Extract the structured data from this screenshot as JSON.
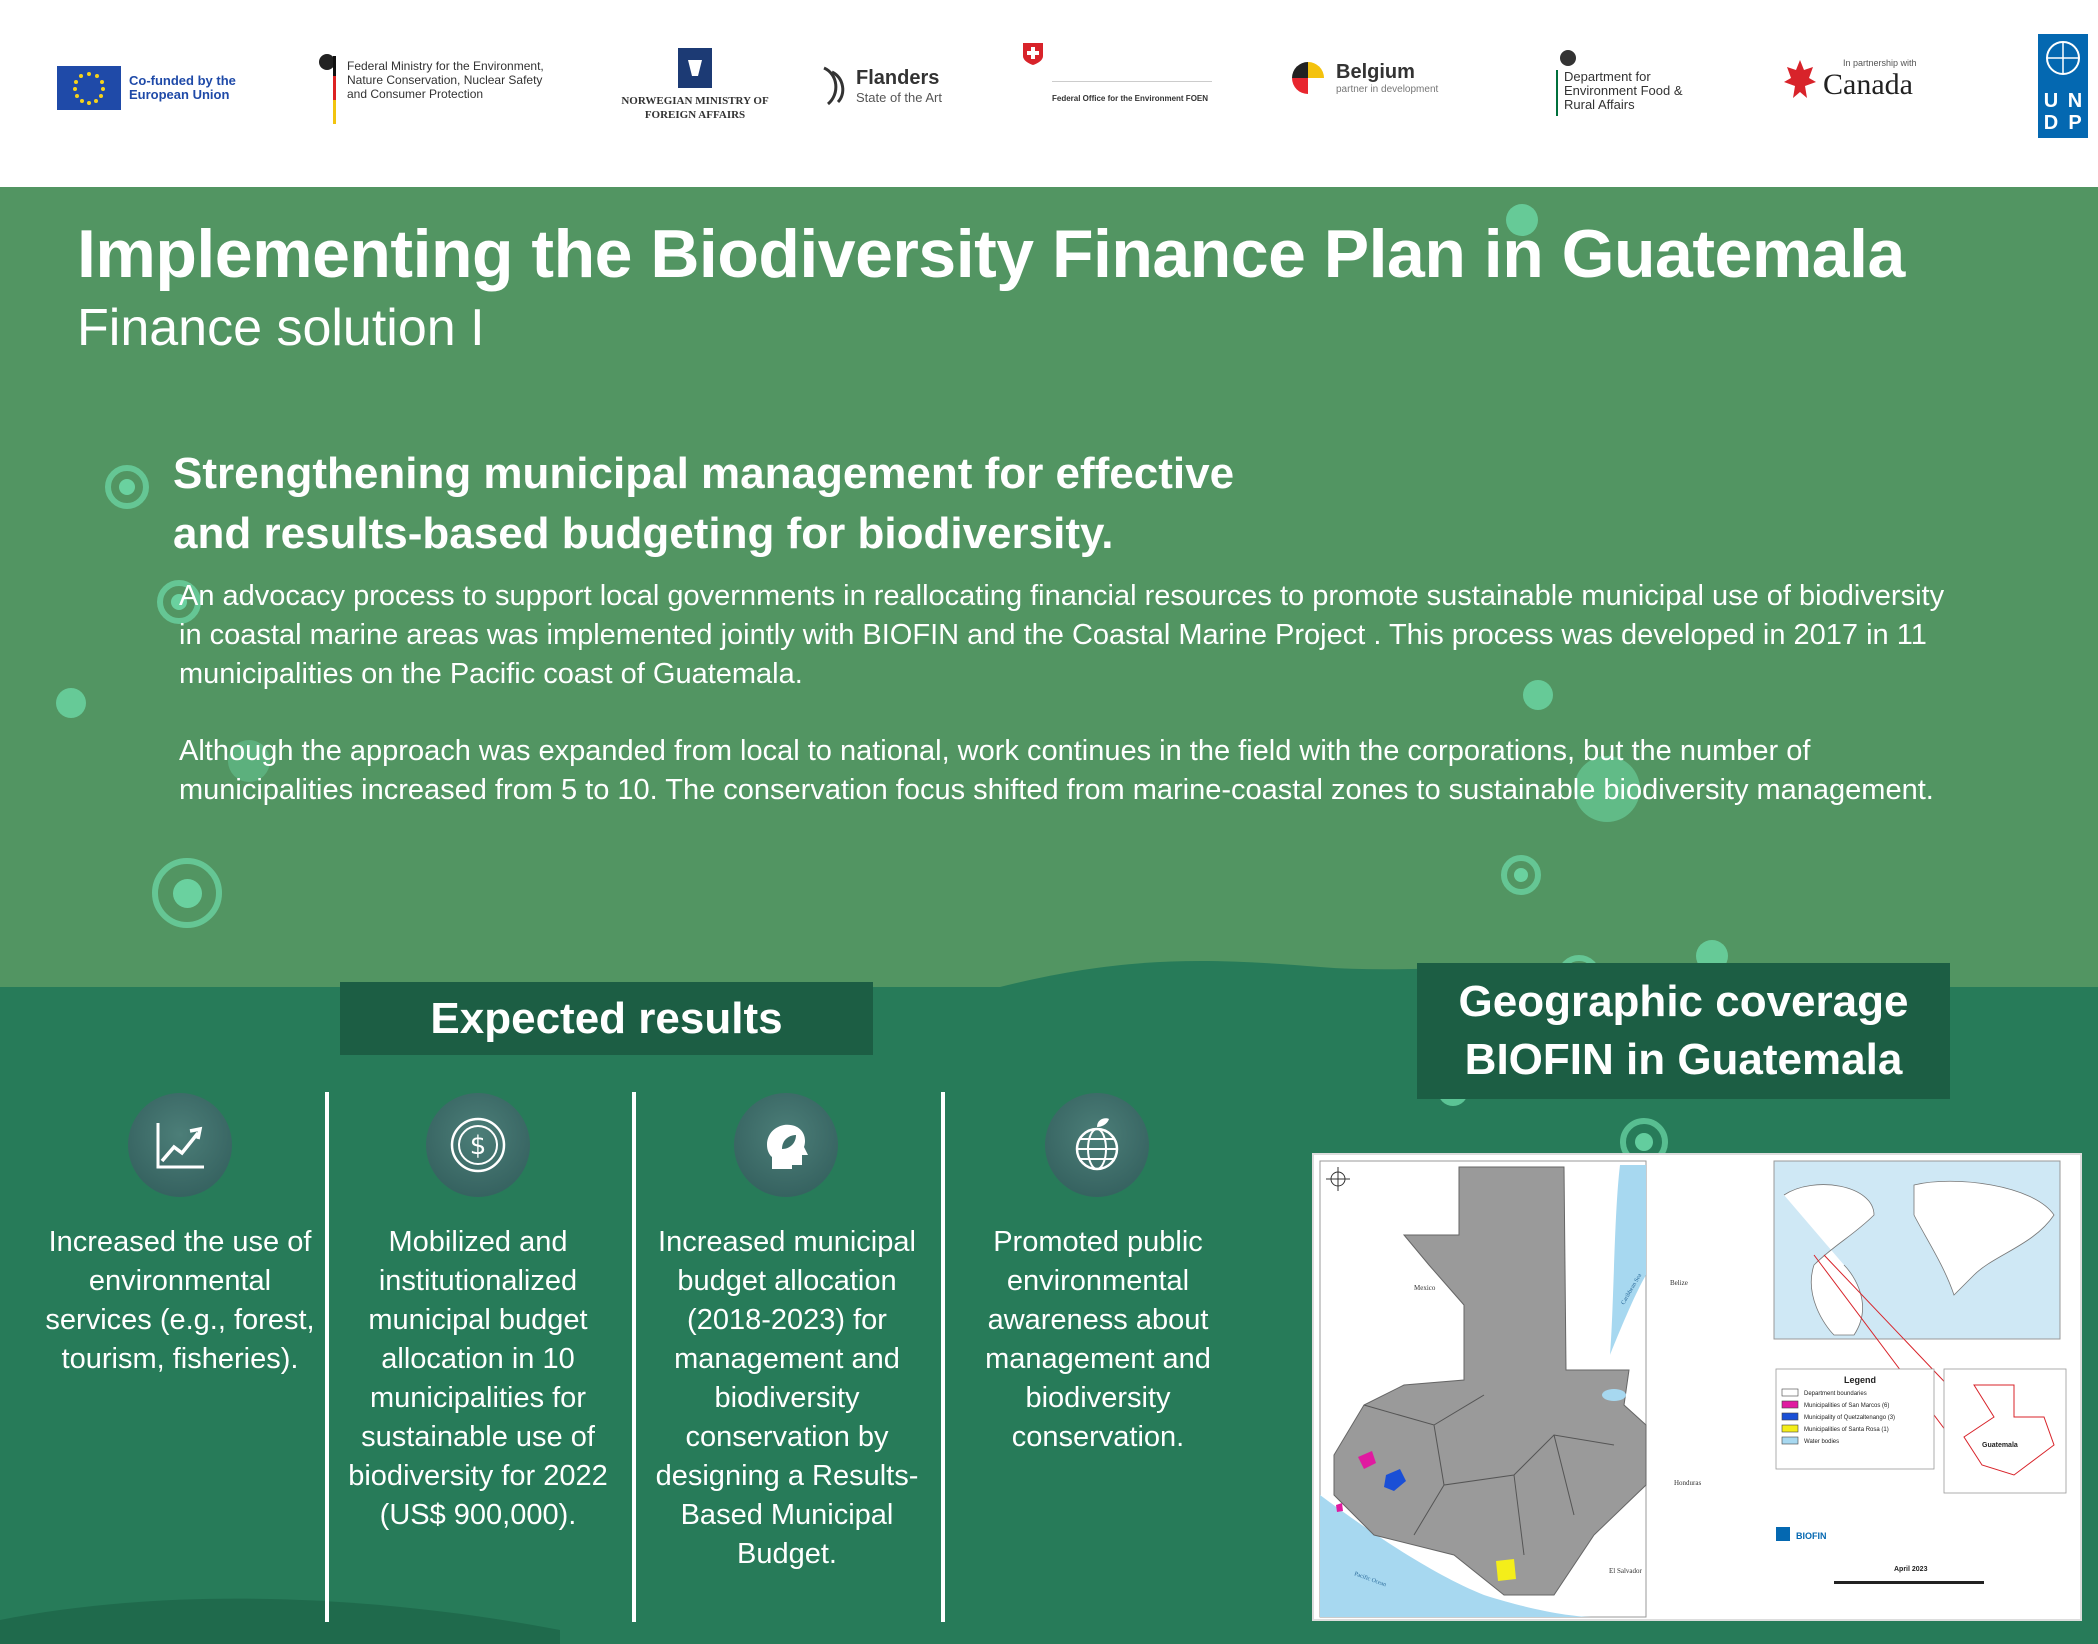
{
  "logos": {
    "eu": "Co-funded by the European Union",
    "germany": "Federal Ministry for the Environment, Nature Conservation, Nuclear Safety and Consumer Protection",
    "norway": "NORWEGIAN MINISTRY OF FOREIGN AFFAIRS",
    "flanders_name": "Flanders",
    "flanders_tag": "State of the Art",
    "swiss": "Federal Office for the Environment FOEN",
    "belgium_name": "Belgium",
    "belgium_tag": "partner in development",
    "uk": "Department for Environment Food & Rural Affairs",
    "canada_tag": "In partnership with",
    "canada_name": "Canada",
    "undp": [
      "U",
      "N",
      "D",
      "P"
    ]
  },
  "header": {
    "title": "Implementing the Biodiversity Finance Plan in Guatemala",
    "subtitle": "Finance solution I"
  },
  "section": {
    "heading_line1": "Strengthening municipal management for effective",
    "heading_line2": "and results-based budgeting for biodiversity.",
    "para1": "An advocacy process to support local governments in reallocating financial resources to promote sustainable municipal use of biodiversity in coastal marine areas was implemented jointly with BIOFIN and the Coastal Marine Project . This process was developed in 2017 in 11 municipalities on the Pacific coast of Guatemala.",
    "para2": "Although the approach was expanded from local to national, work continues in the field with the corporations, but the number of municipalities increased from 5 to 10. The conservation focus shifted from marine-coastal zones to sustainable biodiversity management."
  },
  "results": {
    "title": "Expected results",
    "items": [
      {
        "icon": "trend-up-icon",
        "text": "Increased the use of environmental services (e.g., forest, tourism, fisheries)."
      },
      {
        "icon": "dollar-coin-icon",
        "text": "Mobilized and institutionalized municipal budget allocation in 10 municipalities for sustainable use of biodiversity for 2022 (US$ 900,000)."
      },
      {
        "icon": "head-leaf-icon",
        "text": "Increased municipal budget allocation (2018-2023) for management and biodiversity conservation by designing a Results-Based Municipal Budget."
      },
      {
        "icon": "globe-leaf-icon",
        "text": "Promoted public environmental awareness about management and biodiversity conservation."
      }
    ]
  },
  "geo": {
    "title_line1": "Geographic coverage",
    "title_line2": "BIOFIN in Guatemala"
  },
  "map": {
    "label_mexico": "Mexico",
    "label_belize": "Belize",
    "label_honduras": "Honduras",
    "label_elsalvador": "El Salvador",
    "label_pacific": "Pacific Ocean",
    "label_caribbean": "Caribbean Sea",
    "legend_title": "Legend",
    "legend_items": [
      {
        "color": "#ffffff",
        "label": "Department boundaries"
      },
      {
        "color": "#e01aa0",
        "label": "Municipalities of San Marcos (6)"
      },
      {
        "color": "#1a4fd6",
        "label": "Municipality of Quetzaltenango (3)"
      },
      {
        "color": "#f4ee1a",
        "label": "Municipalities of Santa Rosa (1)"
      },
      {
        "color": "#a7d8f0",
        "label": "Water bodies"
      }
    ],
    "inset_label": "Guatemala",
    "date": "April 2023",
    "biofin": "BIOFIN"
  },
  "colors": {
    "upper_green": "#529562",
    "lower_green": "#277b59",
    "box_green": "#1c5e44",
    "bubble": "#6edcaa"
  }
}
